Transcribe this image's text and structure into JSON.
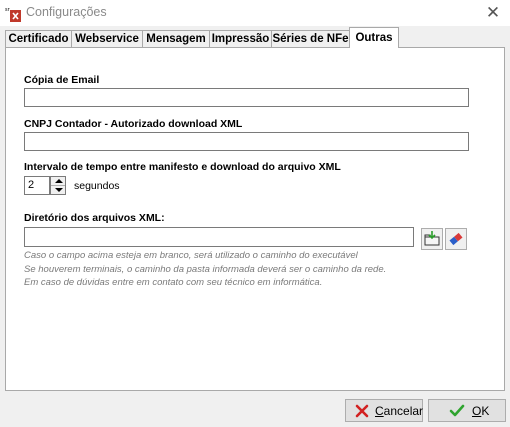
{
  "window": {
    "title": "Configurações",
    "close_glyph": "✕"
  },
  "tabs": [
    {
      "label": "Certificado",
      "active": false
    },
    {
      "label": "Webservice",
      "active": false
    },
    {
      "label": "Mensagem",
      "active": false
    },
    {
      "label": "Impressão",
      "active": false
    },
    {
      "label": "Séries de NFe",
      "active": false
    },
    {
      "label": "Outras",
      "active": true
    }
  ],
  "form": {
    "copia_email": {
      "label": "Cópia de  Email",
      "value": ""
    },
    "cnpj_contador": {
      "label": "CNPJ Contador - Autorizado download XML",
      "value": ""
    },
    "intervalo": {
      "label": "Intervalo de tempo entre manifesto e download do arquivo XML",
      "value": "2",
      "unit": "segundos"
    },
    "diretorio": {
      "label": "Diretório dos arquivos XML:",
      "value": ""
    },
    "hints": [
      "Caso o campo acima esteja em branco, será utilizado o caminho do executável",
      "Se houverem terminais, o caminho da pasta informada deverá ser o caminho da rede.",
      "Em caso de dúvidas entre em contato com seu técnico em informática."
    ]
  },
  "icons": {
    "folder": "folder-open-icon",
    "eraser": "eraser-icon",
    "cancel": "red-x-icon",
    "ok": "green-check-icon"
  },
  "buttons": {
    "cancel": {
      "prefix": "",
      "underlined": "C",
      "rest": "ancelar"
    },
    "ok": {
      "prefix": "",
      "underlined": "O",
      "rest": "K"
    }
  },
  "colors": {
    "panel_bg": "#ffffff",
    "window_bg": "#f0f0f0",
    "hint_text": "#7a7a7a",
    "cancel_icon": "#d22020",
    "ok_icon": "#2fa42f"
  }
}
